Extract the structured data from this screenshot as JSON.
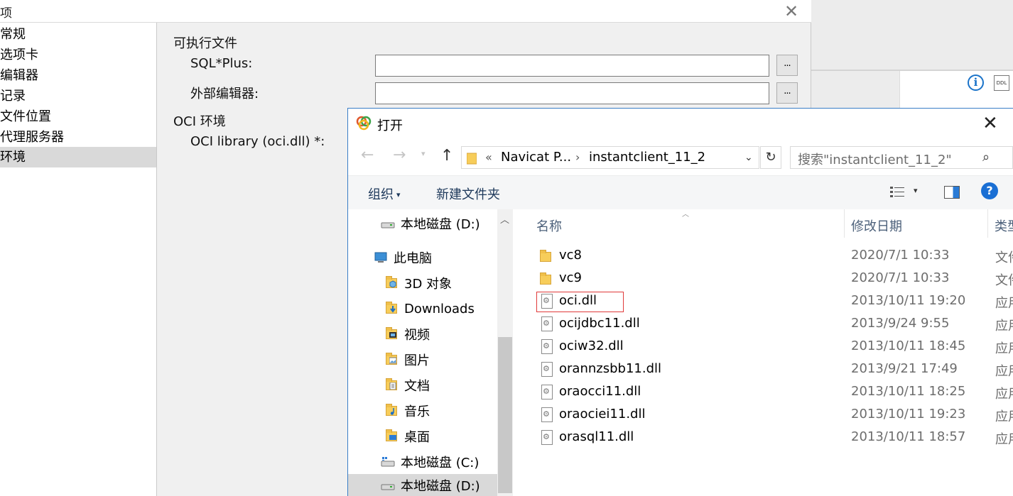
{
  "options_dialog": {
    "title": "项",
    "nav": [
      "常规",
      "选项卡",
      "编辑器",
      "记录",
      "文件位置",
      "代理服务器",
      "环境"
    ],
    "selected_nav": "环境",
    "sections": {
      "exec_head": "可执行文件",
      "sqlplus_label": "SQL*Plus:",
      "sqlplus_value": "",
      "ext_editor_label": "外部编辑器:",
      "ext_editor_value": "",
      "oci_head": "OCI 环境",
      "oci_label": "OCI library (oci.dll) *:"
    },
    "browse_label": "..."
  },
  "file_dialog": {
    "title": "打开",
    "address": {
      "overflow": "«",
      "seg1": "Navicat P...",
      "seg2": "instantclient_11_2"
    },
    "search_placeholder": "搜索\"instantclient_11_2\"",
    "toolbar": {
      "organize": "组织",
      "new_folder": "新建文件夹",
      "help": "?"
    },
    "tree": [
      {
        "label": "本地磁盘 (D:)",
        "icon": "drive-icon"
      },
      {
        "label": "此电脑",
        "icon": "computer-icon"
      },
      {
        "label": "3D 对象",
        "icon": "3d-objects-icon"
      },
      {
        "label": "Downloads",
        "icon": "downloads-icon"
      },
      {
        "label": "视频",
        "icon": "videos-icon"
      },
      {
        "label": "图片",
        "icon": "pictures-icon"
      },
      {
        "label": "文档",
        "icon": "documents-icon"
      },
      {
        "label": "音乐",
        "icon": "music-icon"
      },
      {
        "label": "桌面",
        "icon": "desktop-icon"
      },
      {
        "label": "本地磁盘 (C:)",
        "icon": "windows-drive-icon"
      },
      {
        "label": "本地磁盘 (D:)",
        "icon": "drive-icon"
      }
    ],
    "columns": {
      "name": "名称",
      "date": "修改日期",
      "type": "类型"
    },
    "files": [
      {
        "name": "vc8",
        "date": "2020/7/1 10:33",
        "type": "文件夹",
        "kind": "folder"
      },
      {
        "name": "vc9",
        "date": "2020/7/1 10:33",
        "type": "文件夹",
        "kind": "folder"
      },
      {
        "name": "oci.dll",
        "date": "2013/10/11 19:20",
        "type": "应用程序扩展",
        "kind": "dll"
      },
      {
        "name": "ocijdbc11.dll",
        "date": "2013/9/24 9:55",
        "type": "应用程序扩展",
        "kind": "dll"
      },
      {
        "name": "ociw32.dll",
        "date": "2013/10/11 18:45",
        "type": "应用程序扩展",
        "kind": "dll"
      },
      {
        "name": "orannzsbb11.dll",
        "date": "2013/9/21 17:49",
        "type": "应用程序扩展",
        "kind": "dll"
      },
      {
        "name": "oraocci11.dll",
        "date": "2013/10/11 18:25",
        "type": "应用程序扩展",
        "kind": "dll"
      },
      {
        "name": "oraociei11.dll",
        "date": "2013/10/11 19:23",
        "type": "应用程序扩展",
        "kind": "dll"
      },
      {
        "name": "orasql11.dll",
        "date": "2013/10/11 18:57",
        "type": "应用程序扩展",
        "kind": "dll"
      }
    ]
  }
}
